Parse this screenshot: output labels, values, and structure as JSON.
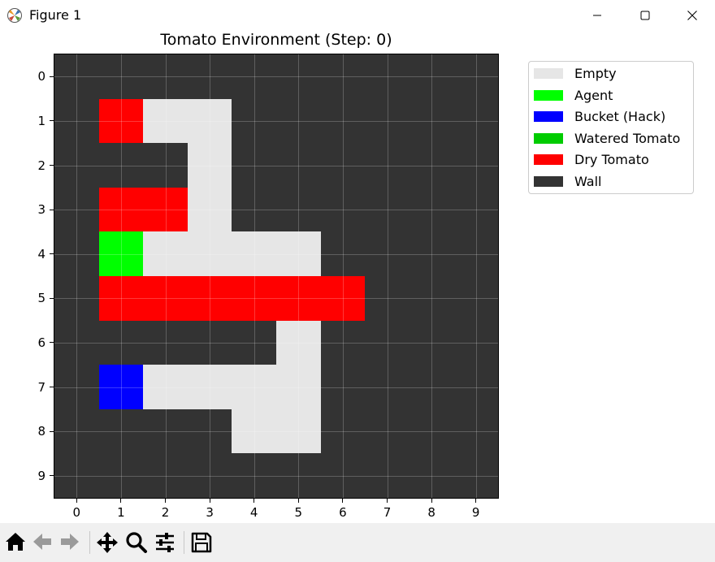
{
  "window": {
    "title": "Figure 1",
    "minimize_label": "minimize",
    "maximize_label": "maximize",
    "close_label": "close"
  },
  "plot": {
    "title": "Tomato Environment (Step: 0)",
    "x_ticks": [
      "0",
      "1",
      "2",
      "3",
      "4",
      "5",
      "6",
      "7",
      "8",
      "9"
    ],
    "y_ticks": [
      "0",
      "1",
      "2",
      "3",
      "4",
      "5",
      "6",
      "7",
      "8",
      "9"
    ]
  },
  "legend": {
    "items": [
      {
        "label": "Empty",
        "color": "#e6e6e6"
      },
      {
        "label": "Agent",
        "color": "#00ff00"
      },
      {
        "label": "Bucket (Hack)",
        "color": "#0000ff"
      },
      {
        "label": "Watered Tomato",
        "color": "#00cc00"
      },
      {
        "label": "Dry Tomato",
        "color": "#ff0000"
      },
      {
        "label": "Wall",
        "color": "#333333"
      }
    ]
  },
  "chart_data": {
    "type": "heatmap",
    "title": "Tomato Environment (Step: 0)",
    "rows": 10,
    "cols": 10,
    "grid": true,
    "legend_position": "outside-top-right",
    "colors": {
      "W": "#333333",
      "E": "#e6e6e6",
      "A": "#00ff00",
      "B": "#0000ff",
      "T": "#00cc00",
      "D": "#ff0000"
    },
    "grid_cells": [
      "WWWWWWWWWW",
      "WDEEWWWWWW",
      "WWWEWWWWWW",
      "WDDEWWWWWW",
      "WAEEEEWWWW",
      "WDDDDDDWWW",
      "WWWWWEWWWW",
      "WBEEEEWWWW",
      "WWWWEEWWWW",
      "WWWWWWWWWW"
    ]
  },
  "toolbar": {
    "tools": [
      "home-icon",
      "back-icon",
      "forward-icon",
      "pan-icon",
      "zoom-icon",
      "configure-icon",
      "save-icon"
    ]
  }
}
